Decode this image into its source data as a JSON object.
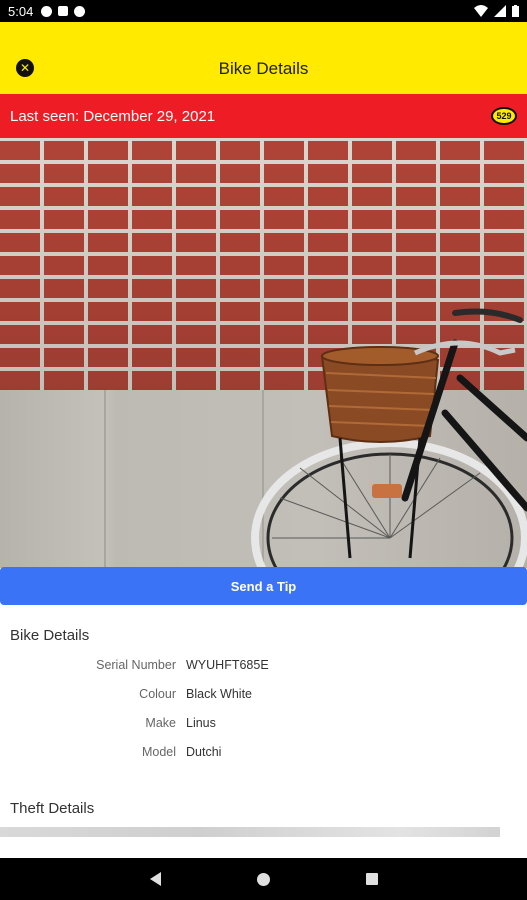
{
  "status_bar": {
    "time": "5:04"
  },
  "header": {
    "title": "Bike Details",
    "close_icon": "close-icon"
  },
  "banner": {
    "last_seen": "Last seen: December 29, 2021",
    "badge_text": "529"
  },
  "photo": {
    "subject": "bike-photo"
  },
  "actions": {
    "send_tip": "Send a Tip"
  },
  "bike_details": {
    "title": "Bike Details",
    "rows": [
      {
        "label": "Serial Number",
        "value": "WYUHFT685E"
      },
      {
        "label": "Colour",
        "value": "Black White"
      },
      {
        "label": "Make",
        "value": "Linus"
      },
      {
        "label": "Model",
        "value": "Dutchi"
      }
    ]
  },
  "theft_details": {
    "title": "Theft Details"
  },
  "colors": {
    "appbar": "#FFEA00",
    "banner": "#EE1C25",
    "button": "#3B73F6"
  }
}
